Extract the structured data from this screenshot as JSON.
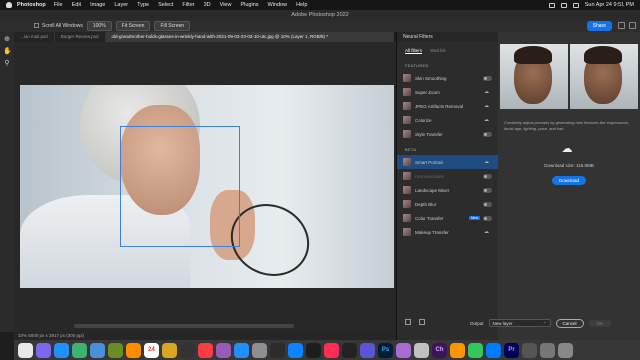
{
  "menubar": {
    "app": "Photoshop",
    "items": [
      "File",
      "Edit",
      "Image",
      "Layer",
      "Type",
      "Select",
      "Filter",
      "3D",
      "View",
      "Plugins",
      "Window",
      "Help"
    ],
    "clock": "Sun Apr 24  9:51 PM"
  },
  "titlebar": {
    "title": "Adobe Photoshop 2022"
  },
  "options": {
    "scroll_all": "Scroll All Windows",
    "zoom": "100%",
    "fit_screen": "Fit Screen",
    "fill_screen": "Fill Screen",
    "share": "Share"
  },
  "tabs": [
    {
      "label": "...ion mail.psd"
    },
    {
      "label": "Burger Review.psd"
    },
    {
      "label": "old-grandmother-holds-glasses-in-wrinkly-hand-with-2021-09-03-23-03-10-utc.jpg @ 10% (Layer 1, RGB/8) *"
    }
  ],
  "statusbar": {
    "text": "10%      6000 px x 3917 px (300 ppi)"
  },
  "neural_filters": {
    "header": "Neural Filters",
    "tabs": [
      "All filters",
      "Wait list"
    ],
    "featured_label": "FEATURED",
    "beta_label": "BETA",
    "featured": [
      {
        "label": "Skin Smoothing",
        "state": "off"
      },
      {
        "label": "Super Zoom",
        "state": "cloud"
      },
      {
        "label": "JPEG Artifacts Removal",
        "state": "cloud"
      },
      {
        "label": "Colorize",
        "state": "cloud"
      },
      {
        "label": "Style Transfer",
        "state": "off"
      }
    ],
    "beta": [
      {
        "label": "Smart Portrait",
        "state": "cloud",
        "selected": true
      },
      {
        "label": "Harmonization",
        "state": "off",
        "disabled": true
      },
      {
        "label": "Landscape Mixer",
        "state": "off"
      },
      {
        "label": "Depth Blur",
        "state": "off"
      },
      {
        "label": "Color Transfer",
        "state": "off",
        "badge": "New"
      },
      {
        "label": "Makeup Transfer",
        "state": "cloud"
      }
    ]
  },
  "detail": {
    "description": "Creatively adjust portraits by generating new features like expressions, facial age, lighting, pose, and hair.",
    "download_size": "Download size: 116.8MB",
    "download_button": "Download"
  },
  "output": {
    "label": "Output",
    "value": "New layer",
    "cancel": "Cancel",
    "ok": "OK"
  },
  "dock": {
    "calendar_date": "24",
    "ps": "Ps",
    "pr": "Pr",
    "ch": "Ch"
  },
  "colors": {
    "accent": "#1473e6",
    "selection": "#3f7fd6"
  }
}
